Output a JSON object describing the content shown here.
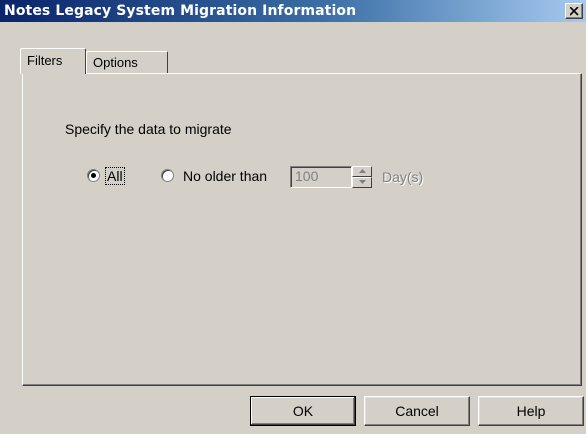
{
  "window": {
    "title": "Notes Legacy System Migration Information"
  },
  "tabs": [
    {
      "label": "Filters",
      "selected": true
    },
    {
      "label": "Options",
      "selected": false
    }
  ],
  "filters": {
    "instruction": "Specify the data to migrate",
    "radio_all": {
      "label": "All",
      "checked": true
    },
    "radio_older": {
      "label": "No older than",
      "checked": false
    },
    "days_value": "100",
    "days_unit": "Day(s)"
  },
  "buttons": {
    "ok": "OK",
    "cancel": "Cancel",
    "help": "Help"
  },
  "colors": {
    "face": "#d4d0c8",
    "title_start": "#0a246a",
    "title_end": "#a6caf0"
  }
}
